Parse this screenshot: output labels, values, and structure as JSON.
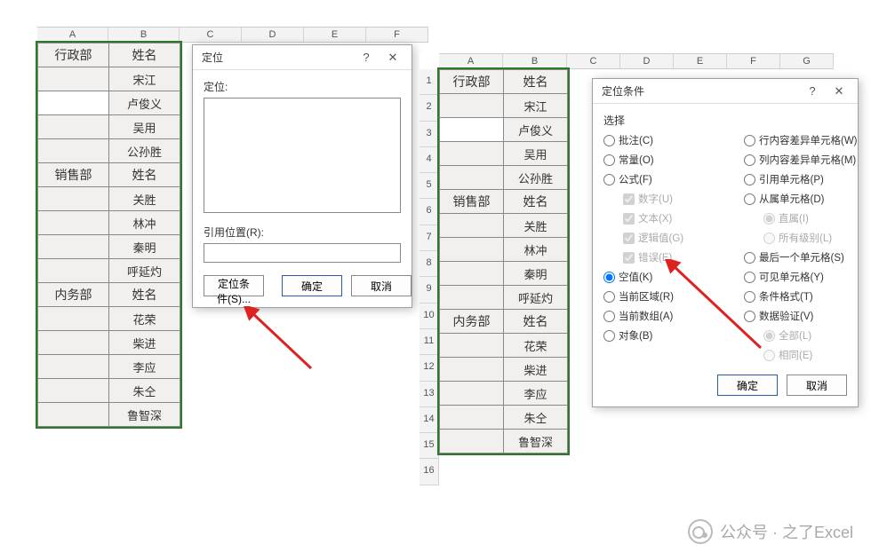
{
  "left_sheet": {
    "col_headers": [
      "A",
      "B",
      "C",
      "D",
      "E",
      "F"
    ],
    "rows": [
      {
        "a": "行政部",
        "b": "姓名",
        "header": true
      },
      {
        "a": "",
        "b": "宋江"
      },
      {
        "a": "",
        "b": "卢俊义",
        "a_white": true
      },
      {
        "a": "",
        "b": "吴用"
      },
      {
        "a": "",
        "b": "公孙胜"
      },
      {
        "a": "销售部",
        "b": "姓名",
        "header": true
      },
      {
        "a": "",
        "b": "关胜"
      },
      {
        "a": "",
        "b": "林冲"
      },
      {
        "a": "",
        "b": "秦明"
      },
      {
        "a": "",
        "b": "呼延灼"
      },
      {
        "a": "内务部",
        "b": "姓名",
        "header": true
      },
      {
        "a": "",
        "b": "花荣"
      },
      {
        "a": "",
        "b": "柴进"
      },
      {
        "a": "",
        "b": "李应"
      },
      {
        "a": "",
        "b": "朱仝"
      },
      {
        "a": "",
        "b": "鲁智深"
      }
    ]
  },
  "right_sheet": {
    "col_headers": [
      "A",
      "B",
      "C",
      "D",
      "E",
      "F",
      "G"
    ],
    "row_headers": [
      "1",
      "2",
      "3",
      "4",
      "5",
      "6",
      "7",
      "8",
      "9",
      "10",
      "11",
      "12",
      "13",
      "14",
      "15",
      "16"
    ],
    "rows": [
      {
        "a": "行政部",
        "b": "姓名",
        "header": true
      },
      {
        "a": "",
        "b": "宋江"
      },
      {
        "a": "",
        "b": "卢俊义",
        "a_white": true
      },
      {
        "a": "",
        "b": "吴用"
      },
      {
        "a": "",
        "b": "公孙胜"
      },
      {
        "a": "销售部",
        "b": "姓名",
        "header": true
      },
      {
        "a": "",
        "b": "关胜"
      },
      {
        "a": "",
        "b": "林冲"
      },
      {
        "a": "",
        "b": "秦明"
      },
      {
        "a": "",
        "b": "呼延灼"
      },
      {
        "a": "内务部",
        "b": "姓名",
        "header": true
      },
      {
        "a": "",
        "b": "花荣"
      },
      {
        "a": "",
        "b": "柴进"
      },
      {
        "a": "",
        "b": "李应"
      },
      {
        "a": "",
        "b": "朱仝"
      },
      {
        "a": "",
        "b": "鲁智深"
      }
    ]
  },
  "dialog_goto": {
    "title": "定位",
    "label_goto": "定位:",
    "label_ref": "引用位置(R):",
    "ref_value": "",
    "btn_special": "定位条件(S)...",
    "btn_ok": "确定",
    "btn_cancel": "取消"
  },
  "dialog_special": {
    "title": "定位条件",
    "group_label": "选择",
    "left_opts": [
      {
        "type": "radio",
        "label": "批注(C)",
        "checked": false
      },
      {
        "type": "radio",
        "label": "常量(O)",
        "checked": false
      },
      {
        "type": "radio",
        "label": "公式(F)",
        "checked": false
      },
      {
        "type": "checkbox",
        "label": "数字(U)",
        "checked": true,
        "indent": true,
        "disabled": true
      },
      {
        "type": "checkbox",
        "label": "文本(X)",
        "checked": true,
        "indent": true,
        "disabled": true
      },
      {
        "type": "checkbox",
        "label": "逻辑值(G)",
        "checked": true,
        "indent": true,
        "disabled": true
      },
      {
        "type": "checkbox",
        "label": "错误(E)",
        "checked": true,
        "indent": true,
        "disabled": true
      },
      {
        "type": "radio",
        "label": "空值(K)",
        "checked": true
      },
      {
        "type": "radio",
        "label": "当前区域(R)",
        "checked": false
      },
      {
        "type": "radio",
        "label": "当前数组(A)",
        "checked": false
      },
      {
        "type": "radio",
        "label": "对象(B)",
        "checked": false
      }
    ],
    "right_opts": [
      {
        "type": "radio",
        "label": "行内容差异单元格(W)",
        "checked": false
      },
      {
        "type": "radio",
        "label": "列内容差异单元格(M)",
        "checked": false
      },
      {
        "type": "radio",
        "label": "引用单元格(P)",
        "checked": false
      },
      {
        "type": "radio",
        "label": "从属单元格(D)",
        "checked": false
      },
      {
        "type": "radio",
        "label": "直属(I)",
        "checked": true,
        "indent": true,
        "disabled": true
      },
      {
        "type": "radio",
        "label": "所有级别(L)",
        "checked": false,
        "indent": true,
        "disabled": true
      },
      {
        "type": "radio",
        "label": "最后一个单元格(S)",
        "checked": false
      },
      {
        "type": "radio",
        "label": "可见单元格(Y)",
        "checked": false
      },
      {
        "type": "radio",
        "label": "条件格式(T)",
        "checked": false
      },
      {
        "type": "radio",
        "label": "数据验证(V)",
        "checked": false
      },
      {
        "type": "radio",
        "label": "全部(L)",
        "checked": true,
        "indent": true,
        "disabled": true
      },
      {
        "type": "radio",
        "label": "相同(E)",
        "checked": false,
        "indent": true,
        "disabled": true
      }
    ],
    "btn_ok": "确定",
    "btn_cancel": "取消"
  },
  "watermark": {
    "text": "公众号 · 之了Excel"
  }
}
